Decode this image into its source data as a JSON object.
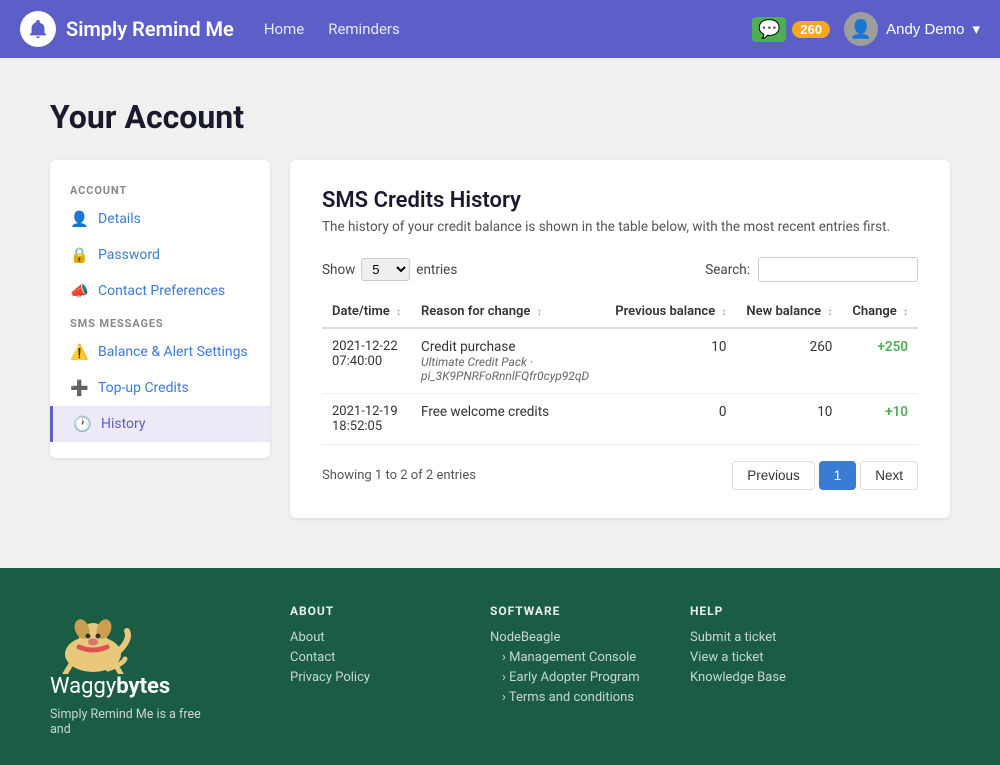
{
  "app": {
    "name": "Simply Remind Me",
    "badge_count": "260"
  },
  "navbar": {
    "links": [
      "Home",
      "Reminders"
    ],
    "user": "Andy Demo"
  },
  "page": {
    "title": "Your Account"
  },
  "sidebar": {
    "sections": [
      {
        "label": "ACCOUNT",
        "items": [
          {
            "id": "details",
            "label": "Details",
            "icon": "👤",
            "active": false
          },
          {
            "id": "password",
            "label": "Password",
            "icon": "🔒",
            "active": false
          },
          {
            "id": "contact-preferences",
            "label": "Contact Preferences",
            "icon": "📣",
            "active": false
          }
        ]
      },
      {
        "label": "SMS MESSAGES",
        "items": [
          {
            "id": "balance-alert",
            "label": "Balance & Alert Settings",
            "icon": "⚠️",
            "active": false
          },
          {
            "id": "top-up-credits",
            "label": "Top-up Credits",
            "icon": "➕",
            "active": false
          },
          {
            "id": "history",
            "label": "History",
            "icon": "🕐",
            "active": true
          }
        ]
      }
    ]
  },
  "panel": {
    "title": "SMS Credits History",
    "subtitle": "The history of your credit balance is shown in the table below, with the most recent entries first.",
    "show_label": "Show",
    "show_value": "5",
    "entries_label": "entries",
    "search_label": "Search:",
    "search_placeholder": "",
    "columns": [
      "Date/time",
      "Reason for change",
      "Previous balance",
      "New balance",
      "Change"
    ],
    "rows": [
      {
        "datetime": "2021-12-22\n07:40:00",
        "datetime_line1": "2021-12-22",
        "datetime_line2": "07:40:00",
        "reason_main": "Credit purchase",
        "reason_sub": "Ultimate Credit Pack · pi_3K9PNRFoRnnlFQfr0cyp92qD",
        "prev_balance": "10",
        "new_balance": "260",
        "change": "+250",
        "change_color": "positive"
      },
      {
        "datetime_line1": "2021-12-19",
        "datetime_line2": "18:52:05",
        "reason_main": "Free welcome credits",
        "reason_sub": "",
        "prev_balance": "0",
        "new_balance": "10",
        "change": "+10",
        "change_color": "positive"
      }
    ],
    "showing_info": "Showing 1 to 2 of 2 entries",
    "pagination": {
      "prev_label": "Previous",
      "next_label": "Next",
      "current_page": "1"
    }
  },
  "footer": {
    "brand_name_start": "Waggy",
    "brand_name_bold": "bytes",
    "tagline": "Simply Remind Me is a free and",
    "sections": [
      {
        "title": "ABOUT",
        "links": [
          {
            "label": "About",
            "sub": false
          },
          {
            "label": "Contact",
            "sub": false
          },
          {
            "label": "Privacy Policy",
            "sub": false
          }
        ]
      },
      {
        "title": "SOFTWARE",
        "links": [
          {
            "label": "NodeBeagle",
            "sub": false
          },
          {
            "label": "Management Console",
            "sub": true
          },
          {
            "label": "Early Adopter Program",
            "sub": true
          },
          {
            "label": "Terms and conditions",
            "sub": true
          }
        ]
      },
      {
        "title": "HELP",
        "links": [
          {
            "label": "Submit a ticket",
            "sub": false
          },
          {
            "label": "View a ticket",
            "sub": false
          },
          {
            "label": "Knowledge Base",
            "sub": false
          }
        ]
      }
    ]
  }
}
